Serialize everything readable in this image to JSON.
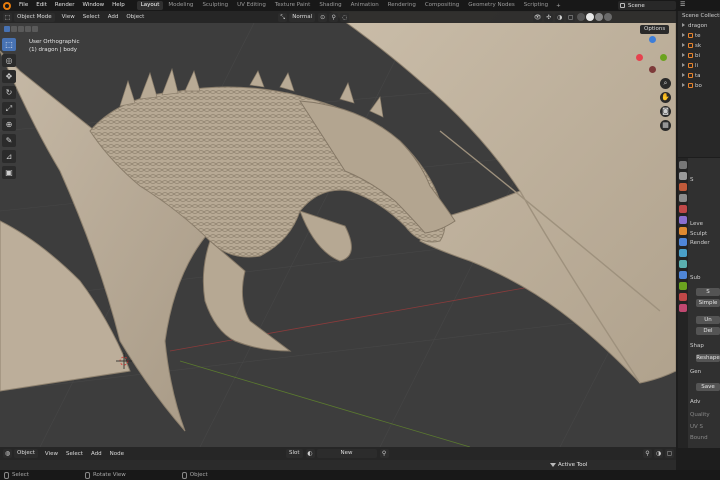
{
  "topbar": {
    "menus": [
      "File",
      "Edit",
      "Render",
      "Window",
      "Help"
    ],
    "workspaces": [
      {
        "label": "Layout",
        "active": true
      },
      {
        "label": "Modeling",
        "active": false
      },
      {
        "label": "Sculpting",
        "active": false
      },
      {
        "label": "UV Editing",
        "active": false
      },
      {
        "label": "Texture Paint",
        "active": false
      },
      {
        "label": "Shading",
        "active": false
      },
      {
        "label": "Animation",
        "active": false
      },
      {
        "label": "Rendering",
        "active": false
      },
      {
        "label": "Compositing",
        "active": false
      },
      {
        "label": "Geometry Nodes",
        "active": false
      },
      {
        "label": "Scripting",
        "active": false
      }
    ],
    "add_workspace": "+",
    "scene": "Scene"
  },
  "viewport_header": {
    "mode": "Object Mode",
    "menus": [
      "View",
      "Select",
      "Add",
      "Object"
    ],
    "orientation": "Normal",
    "options": "Options"
  },
  "viewport": {
    "view_name": "User Orthographic",
    "object_info": "(1) dragon | body",
    "model_color": "#b9ab98"
  },
  "toolbar": {
    "tools": [
      {
        "icon": "select-box-icon",
        "glyph": "⬚",
        "active": true
      },
      {
        "icon": "cursor-icon",
        "glyph": "◎",
        "active": false
      },
      {
        "icon": "move-icon",
        "glyph": "✥",
        "active": false
      },
      {
        "icon": "rotate-icon",
        "glyph": "↻",
        "active": false
      },
      {
        "icon": "scale-icon",
        "glyph": "⤢",
        "active": false
      },
      {
        "icon": "transform-icon",
        "glyph": "⊕",
        "active": false
      },
      {
        "icon": "annotate-icon",
        "glyph": "✎",
        "active": false
      },
      {
        "icon": "measure-icon",
        "glyph": "📐",
        "active": false
      },
      {
        "icon": "add-cube-icon",
        "glyph": "▣",
        "active": false
      }
    ]
  },
  "outliner": {
    "header": "Scene Collection",
    "rows": [
      "dragon",
      "te",
      "sk",
      "bi",
      "li",
      "ta",
      "bo"
    ]
  },
  "properties": {
    "rows": [
      {
        "label": "S",
        "kind": "text"
      },
      {
        "label": "Leve",
        "kind": "text"
      },
      {
        "label": "Sculpt",
        "kind": "text"
      },
      {
        "label": "Render",
        "kind": "text"
      },
      {
        "label": "Sub",
        "kind": "text"
      },
      {
        "label": "S",
        "kind": "button"
      },
      {
        "label": "Simple",
        "kind": "button"
      },
      {
        "label": "Un",
        "kind": "button"
      },
      {
        "label": "Del",
        "kind": "button"
      },
      {
        "label": "Shap",
        "kind": "text"
      },
      {
        "label": "Reshape",
        "kind": "button"
      },
      {
        "label": "Gen",
        "kind": "text"
      },
      {
        "label": "Save",
        "kind": "button"
      },
      {
        "label": "Adv",
        "kind": "text"
      },
      {
        "label": "Quality",
        "kind": "text"
      },
      {
        "label": "UV S",
        "kind": "text"
      },
      {
        "label": "Bound",
        "kind": "text"
      }
    ]
  },
  "bottom_editor": {
    "mode": "Object",
    "menus": [
      "View",
      "Select",
      "Add",
      "Node"
    ],
    "slot": "Slot",
    "new_button": "New",
    "active_tool_label": "Active Tool"
  },
  "statusbar": {
    "items": [
      "Select",
      "Rotate View",
      "Object"
    ]
  },
  "colors": {
    "accent": "#4772b3",
    "background_viewport": "#3d3d3d",
    "gizmo_x": "#e6424e",
    "gizmo_y": "#6ba31f",
    "gizmo_z": "#3d7ed9"
  }
}
